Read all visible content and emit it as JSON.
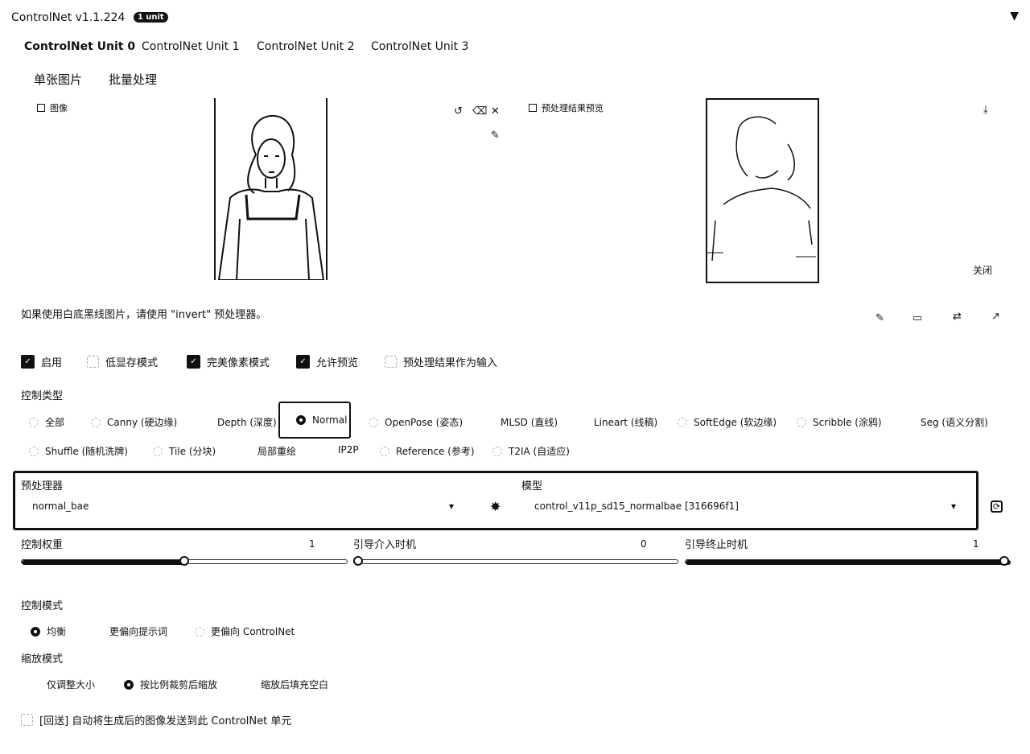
{
  "header": {
    "title": "ControlNet v1.1.224",
    "badge": "1 unit",
    "collapse_icon": "triangle-down"
  },
  "unit_tabs": [
    "ControlNet Unit 0",
    "ControlNet Unit 1",
    "ControlNet Unit 2",
    "ControlNet Unit 3"
  ],
  "active_unit_tab": 0,
  "sub_tabs": [
    "单张图片",
    "批量处理"
  ],
  "image_panel": {
    "label": "图像",
    "tools": [
      "↺",
      "⌫",
      "✕"
    ],
    "tool_extra": "✎"
  },
  "preview_panel": {
    "label": "预处理结果预览",
    "download_icon": "⤓",
    "close_label": "关闭"
  },
  "note": "如果使用白底黑线图片，请使用 \"invert\" 预处理器。",
  "action_icons": [
    "✎",
    "▭",
    "⇄",
    "↗"
  ],
  "checkboxes": [
    {
      "label": "启用",
      "checked": true
    },
    {
      "label": "低显存模式",
      "checked": false
    },
    {
      "label": "完美像素模式",
      "checked": true
    },
    {
      "label": "允许预览",
      "checked": true
    },
    {
      "label": "预处理结果作为输入",
      "checked": false
    }
  ],
  "control_type": {
    "label": "控制类型",
    "row1": [
      "全部",
      "Canny (硬边缘)",
      "Depth (深度)",
      "Normal",
      "OpenPose (姿态)",
      "MLSD (直线)",
      "Lineart (线稿)",
      "SoftEdge (软边缘)",
      "Scribble (涂鸦)",
      "Seg (语义分割)"
    ],
    "row2": [
      "Shuffle (随机洗牌)",
      "Tile (分块)",
      "局部重绘",
      "IP2P",
      "Reference (参考)",
      "T2IA (自适应)"
    ],
    "selected": "Normal"
  },
  "preprocessor": {
    "label": "预处理器",
    "value": "normal_bae",
    "run_icon": "✸"
  },
  "model": {
    "label": "模型",
    "value": "control_v11p_sd15_normalbae [316696f1]",
    "refresh_icon": "⟳"
  },
  "sliders": [
    {
      "label": "控制权重",
      "value": "1",
      "fraction": 0.5
    },
    {
      "label": "引导介入时机",
      "value": "0",
      "fraction": 0.0
    },
    {
      "label": "引导终止时机",
      "value": "1",
      "fraction": 1.0
    }
  ],
  "control_mode": {
    "label": "控制模式",
    "options": [
      "均衡",
      "更偏向提示词",
      "更偏向 ControlNet"
    ],
    "selected": "均衡"
  },
  "resize_mode": {
    "label": "缩放模式",
    "options": [
      "仅调整大小",
      "按比例裁剪后缩放",
      "缩放后填充空白"
    ],
    "selected": "按比例裁剪后缩放"
  },
  "loopback": {
    "label": "[回送] 自动将生成后的图像发送到此 ControlNet 单元",
    "checked": false
  }
}
